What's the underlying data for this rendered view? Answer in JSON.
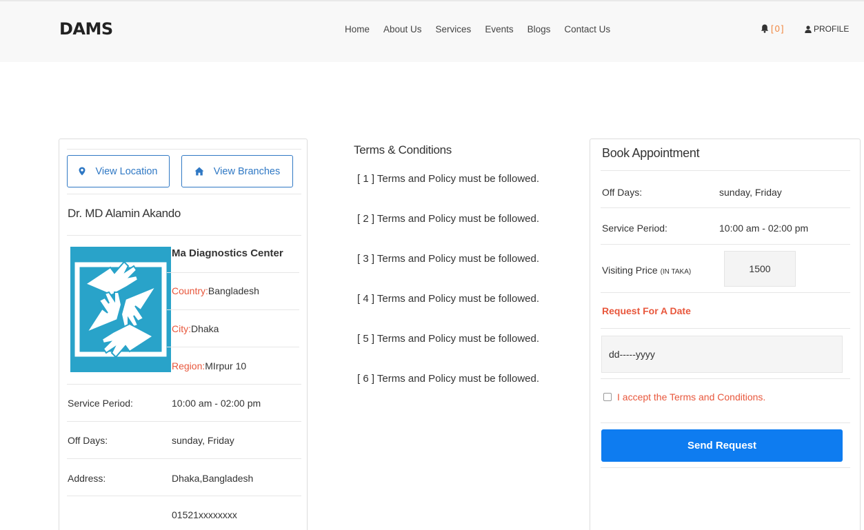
{
  "navbar": {
    "brand": "DAMS",
    "links": [
      "Home",
      "About Us",
      "Services",
      "Events",
      "Blogs",
      "Contact Us"
    ],
    "notification_open": "[",
    "notification_count": "0",
    "notification_close": "]",
    "profile_label": "PROFILE"
  },
  "left_card": {
    "view_location_label": "View Location",
    "view_branches_label": "View Branches",
    "doctor_name": "Dr. MD Alamin Akando",
    "center_name": "Ma Diagnostics Center",
    "country_label": "Country:",
    "country_value": "Bangladesh",
    "city_label": "City:",
    "city_value": "Dhaka",
    "region_label": "Region:",
    "region_value": "MIrpur 10",
    "service_period_label": "Service Period:",
    "service_period_value": "10:00 am - 02:00 pm",
    "off_days_label": "Off Days:",
    "off_days_value": "sunday, Friday",
    "address_label": "Address:",
    "address_value": "Dhaka,Bangladesh",
    "phone_value": "01521xxxxxxxx"
  },
  "terms": {
    "title": "Terms & Conditions",
    "items": [
      "[ 1 ] Terms and Policy must be followed.",
      "[ 2 ] Terms and Policy must be followed.",
      "[ 3 ] Terms and Policy must be followed.",
      "[ 4 ] Terms and Policy must be followed.",
      "[ 5 ] Terms and Policy must be followed.",
      "[ 6 ] Terms and Policy must be followed."
    ]
  },
  "booking": {
    "title": "Book Appointment",
    "off_days_label": "Off Days:",
    "off_days_value": "sunday, Friday",
    "service_period_label": "Service Period:",
    "service_period_value": "10:00 am - 02:00 pm",
    "visiting_price_label": "Visiting Price",
    "visiting_price_unit": "(IN TAKA)",
    "visiting_price_value": "1500",
    "request_date_label": "Request For A Date",
    "date_placeholder": "dd-----yyyy",
    "accept_label": "I accept the Terms and Conditions.",
    "send_label": "Send Request"
  },
  "colors": {
    "accent_blue": "#0e7cf0",
    "outline_blue": "#2f78c4",
    "label_red": "#e8573c",
    "logo_teal": "#29a3c9",
    "notification_orange": "#f0843c"
  }
}
